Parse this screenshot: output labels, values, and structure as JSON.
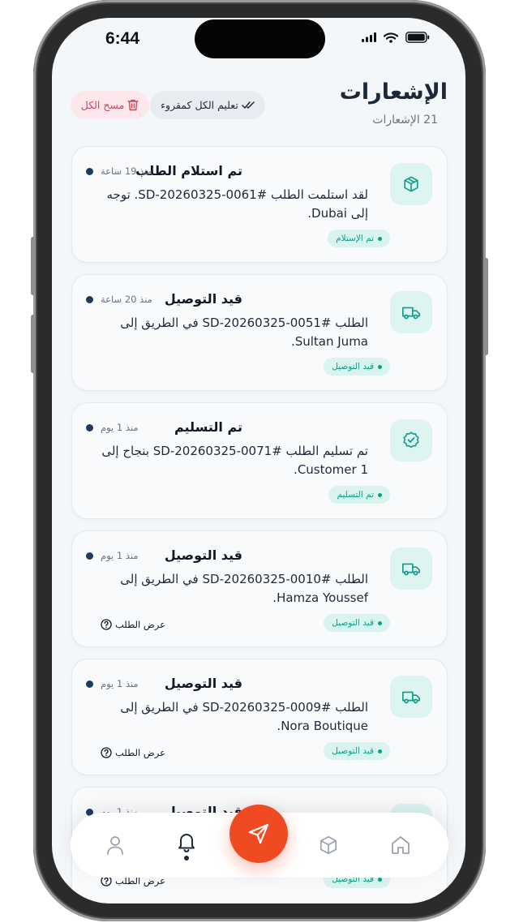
{
  "status_bar": {
    "time": "6:44"
  },
  "header": {
    "title": "الإشعارات",
    "count_text": "21 الإشعارات",
    "mark_all_label": "تعليم الكل كمقروء",
    "clear_all_label": "مسح الكل"
  },
  "notifications": [
    {
      "title": "تم استلام الطلب",
      "time": "منذ 19 ساعة",
      "message": "لقد استلمت الطلب #SD-20260325-0061. توجه إلى Dubai.",
      "status": "تم الإستلام",
      "icon": "package-icon"
    },
    {
      "title": "قيد التوصيل",
      "time": "منذ 20 ساعة",
      "message": "الطلب #SD-20260325-0051 في الطريق إلى Sultan Juma.",
      "status": "قيد التوصيل",
      "icon": "truck-icon"
    },
    {
      "title": "تم التسليم",
      "time": "منذ 1 يوم",
      "message": "تم تسليم الطلب #SD-20260325-0071 بنجاح إلى Customer 1.",
      "status": "تم التسليم",
      "icon": "check-badge-icon"
    },
    {
      "title": "قيد التوصيل",
      "time": "منذ 1 يوم",
      "message": "الطلب #SD-20260325-0010 في الطريق إلى Hamza Youssef.",
      "status": "قيد التوصيل",
      "view_order": "عرض الطلب",
      "icon": "truck-icon"
    },
    {
      "title": "قيد التوصيل",
      "time": "منذ 1 يوم",
      "message": "الطلب #SD-20260325-0009 في الطريق إلى Nora Boutique.",
      "status": "قيد التوصيل",
      "view_order": "عرض الطلب",
      "icon": "truck-icon"
    },
    {
      "title": "قيد التوصيل",
      "time": "منذ 1 يوم",
      "message": "",
      "status": "قيد التوصيل",
      "view_order": "عرض الطلب",
      "icon": "truck-icon"
    }
  ],
  "bottom_nav": {
    "items": [
      "profile-icon",
      "bell-icon",
      "send-icon",
      "package-icon",
      "home-icon"
    ],
    "active": "bell-icon"
  },
  "colors": {
    "accent": "#f04a23",
    "teal": "#0f9d8a",
    "teal_bg": "#ddf4f1",
    "danger": "#e23b57"
  }
}
